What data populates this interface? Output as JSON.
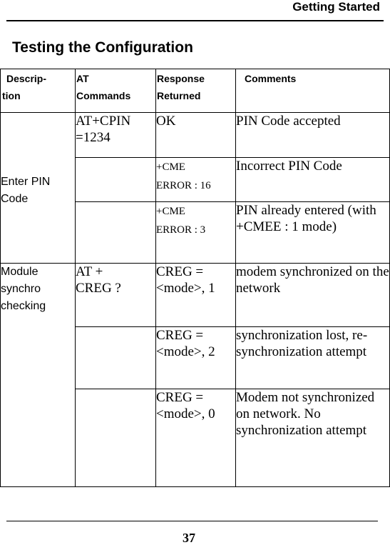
{
  "page": {
    "running_header": "Getting Started",
    "section_title": "Testing the Configuration",
    "page_number": "37"
  },
  "table": {
    "headers": [
      {
        "line1": "Descrip-",
        "line2": "tion"
      },
      {
        "line1": "AT",
        "line2": "Commands"
      },
      {
        "line1": "Response",
        "line2": "Returned"
      },
      {
        "line1": "Comments",
        "line2": ""
      }
    ],
    "groups": [
      {
        "description": [
          "Enter PIN",
          "Code"
        ],
        "rows": [
          {
            "command": [
              "AT+CPIN",
              "=1234"
            ],
            "response": [
              "OK"
            ],
            "comment": "PIN Code accepted"
          },
          {
            "command": [],
            "response": [
              "+CME",
              "ERROR : 16"
            ],
            "comment": "Incorrect PIN Code"
          },
          {
            "command": [],
            "response": [
              "+CME",
              "ERROR : 3"
            ],
            "comment": "PIN already entered (with +CMEE : 1 mode)"
          }
        ]
      },
      {
        "description": [
          "Module",
          "synchro",
          "checking"
        ],
        "rows": [
          {
            "command": [
              "AT +",
              "CREG ?"
            ],
            "response": [
              "CREG =",
              "<mode>, 1"
            ],
            "comment": "modem synchronized on the network"
          },
          {
            "command": [],
            "response": [
              "CREG =",
              "<mode>, 2"
            ],
            "comment": "synchronization lost, re-synchronization attempt"
          },
          {
            "command": [],
            "response": [
              "CREG =",
              "<mode>, 0"
            ],
            "comment": "Modem not synchronized on network.  No synchronization attempt"
          }
        ]
      }
    ]
  }
}
